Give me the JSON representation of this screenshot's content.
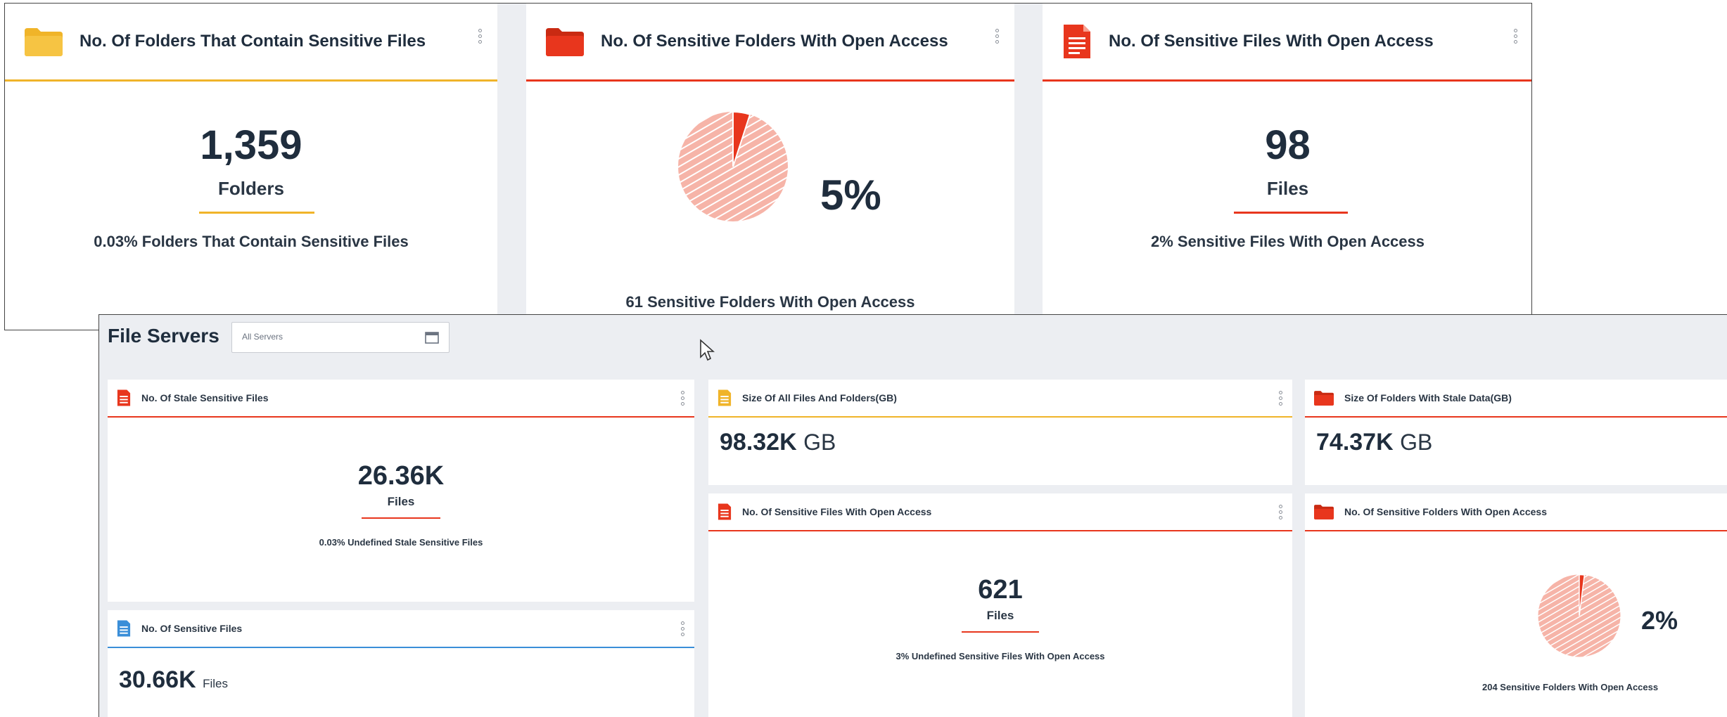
{
  "top": {
    "card1": {
      "title": "No. Of Folders That Contain Sensitive Files",
      "icon": "folder-icon",
      "accent": "#f0b429",
      "value": "1,359",
      "unit": "Folders",
      "description": "0.03% Folders That Contain Sensitive Files"
    },
    "card2": {
      "title": "No. Of Sensitive Folders With Open Access",
      "icon": "folder-icon",
      "accent": "#e8361d",
      "percent_label": "5%",
      "percent": 5,
      "description": "61 Sensitive Folders With Open Access"
    },
    "card3": {
      "title": "No. Of Sensitive Files With Open Access",
      "icon": "document-icon",
      "accent": "#e8361d",
      "value": "98",
      "unit": "Files",
      "description": "2% Sensitive Files With Open Access"
    }
  },
  "file_servers": {
    "title": "File Servers",
    "selector_value": "All Servers",
    "stale_files": {
      "title": "No. Of Stale Sensitive Files",
      "icon": "document-icon",
      "accent": "#e8361d",
      "value": "26.36K",
      "unit": "Files",
      "description": "0.03% Undefined Stale Sensitive Files"
    },
    "sensitive_files": {
      "title": "No. Of Sensitive Files",
      "icon": "document-icon",
      "accent": "#3a8ed8",
      "value": "30.66K",
      "unit": "Files"
    },
    "size_all": {
      "title": "Size Of All Files And Folders(GB)",
      "icon": "document-icon",
      "accent": "#f0b429",
      "value": "98.32K",
      "unit": "GB"
    },
    "open_access_files": {
      "title": "No. Of Sensitive Files With Open Access",
      "icon": "document-icon",
      "accent": "#e8361d",
      "value": "621",
      "unit": "Files",
      "description": "3% Undefined Sensitive Files With Open Access"
    },
    "stale_size": {
      "title": "Size Of Folders With Stale Data(GB)",
      "icon": "folder-icon",
      "accent": "#e8361d",
      "value": "74.37K",
      "unit": "GB"
    },
    "open_access_folders": {
      "title": "No. Of Sensitive Folders With Open Access",
      "icon": "folder-icon",
      "accent": "#e8361d",
      "percent_label": "2%",
      "percent": 2,
      "description": "204 Sensitive Folders With Open Access"
    }
  }
}
